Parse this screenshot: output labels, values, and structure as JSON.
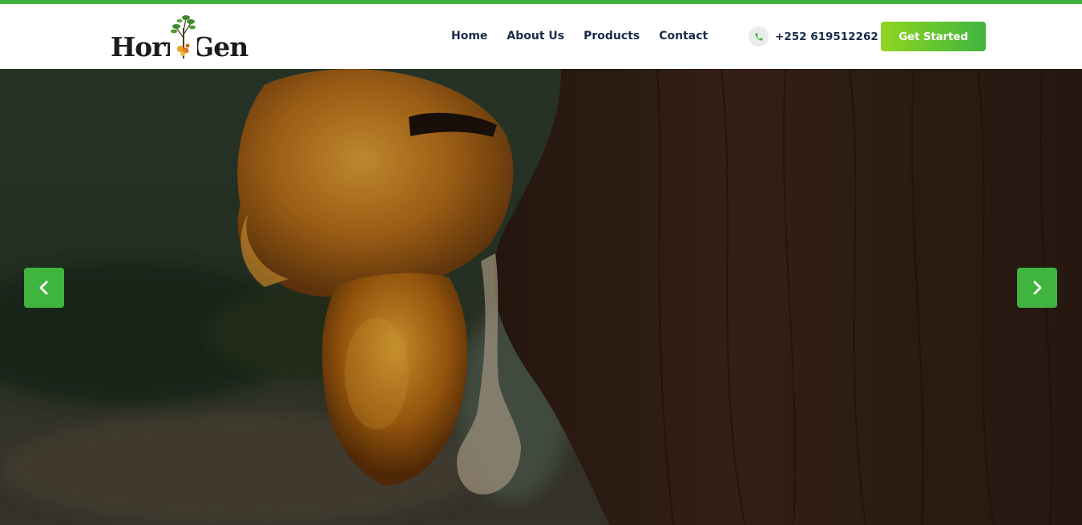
{
  "colors": {
    "accent": "#3fb53f",
    "accent_light": "#8fd620",
    "nav_text": "#1b2a4a"
  },
  "brand": {
    "logo_text": "Horn Gen",
    "logo_icon": "acacia-tree-icon"
  },
  "nav": {
    "items": [
      {
        "label": "Home"
      },
      {
        "label": "About Us"
      },
      {
        "label": "Products"
      },
      {
        "label": "Contact"
      }
    ]
  },
  "contact": {
    "phone_icon": "phone-icon",
    "phone": "+252 619512262"
  },
  "cta": {
    "label": "Get Started"
  },
  "slider": {
    "image_subject": "resin-on-tree-bark",
    "prev_icon": "chevron-left-icon",
    "next_icon": "chevron-right-icon"
  }
}
